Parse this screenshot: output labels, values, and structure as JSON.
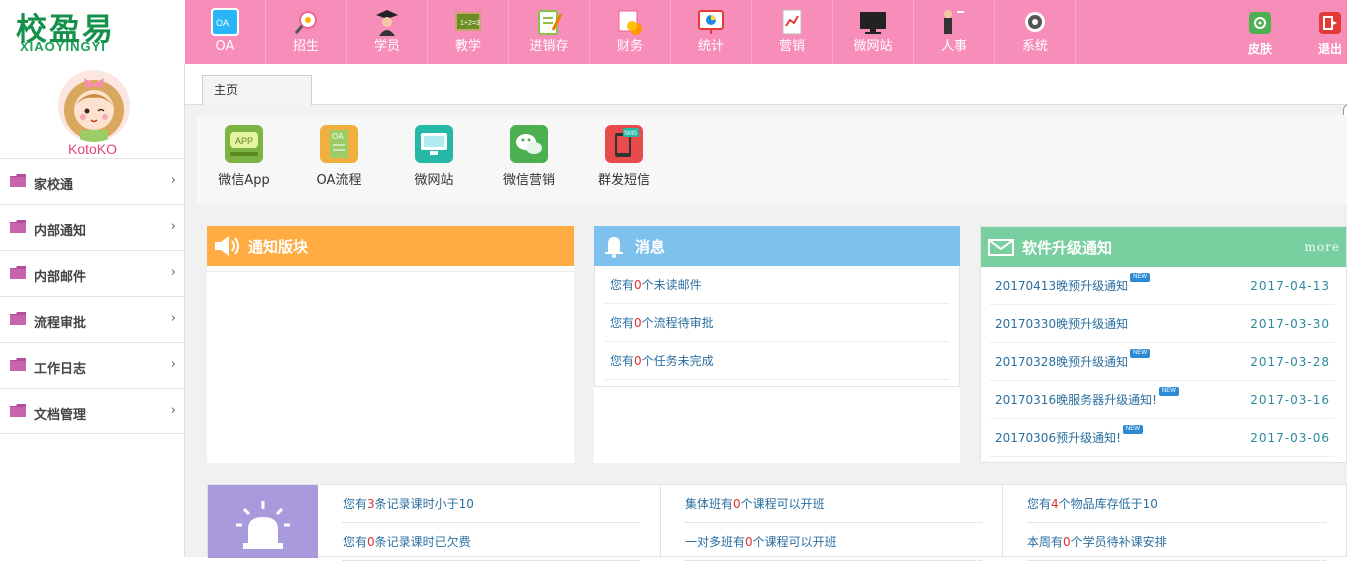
{
  "logo": {
    "cn": "校盈易",
    "en": "XIAOYINGYI"
  },
  "nav": [
    {
      "label": "OA",
      "icon": "oa-icon",
      "color": "#29b6f6"
    },
    {
      "label": "招生",
      "icon": "recruit-icon",
      "color": "#f06292"
    },
    {
      "label": "学员",
      "icon": "student-icon",
      "color": "#333333"
    },
    {
      "label": "教学",
      "icon": "teaching-icon",
      "color": "#8bc34a"
    },
    {
      "label": "进销存",
      "icon": "inventory-icon",
      "color": "#8bc34a"
    },
    {
      "label": "财务",
      "icon": "finance-icon",
      "color": "#ff9800"
    },
    {
      "label": "统计",
      "icon": "statistics-icon",
      "color": "#e53935"
    },
    {
      "label": "营销",
      "icon": "marketing-icon",
      "color": "#f5f5f5"
    },
    {
      "label": "微网站",
      "icon": "microsite-icon",
      "color": "#222222"
    },
    {
      "label": "人事",
      "icon": "personnel-icon",
      "color": "#333333"
    },
    {
      "label": "系统",
      "icon": "settings-icon",
      "color": "#444444"
    }
  ],
  "header_right": {
    "skin": {
      "label": "皮肤",
      "icon": "skin-icon",
      "color": "#4caf50"
    },
    "logout": {
      "label": "退出",
      "icon": "logout-icon",
      "color": "#e53935"
    }
  },
  "user": {
    "name": "KotoKO"
  },
  "sidebar": [
    {
      "label": "家校通"
    },
    {
      "label": "内部通知"
    },
    {
      "label": "内部邮件"
    },
    {
      "label": "流程审批"
    },
    {
      "label": "工作日志"
    },
    {
      "label": "文档管理"
    }
  ],
  "tabs": [
    {
      "label": "主页"
    }
  ],
  "shortcuts": [
    {
      "label": "微信App",
      "icon": "wechat-app-icon",
      "color": "#7cb342",
      "badge": "APP"
    },
    {
      "label": "OA流程",
      "icon": "oa-flow-icon",
      "color": "#f0b040",
      "badge": "OA"
    },
    {
      "label": "微网站",
      "icon": "microsite-icon",
      "color": "#26b8a6",
      "badge": ""
    },
    {
      "label": "微信营销",
      "icon": "wechat-marketing-icon",
      "color": "#4caf50",
      "badge": ""
    },
    {
      "label": "群发短信",
      "icon": "sms-icon",
      "color": "#e94b4b",
      "badge": "SMS"
    }
  ],
  "notice_panel": {
    "title": "通知版块",
    "color": "#ffac42"
  },
  "message_panel": {
    "title": "消息",
    "color": "#7ec1ec",
    "rows": [
      {
        "pre": "您有",
        "num": "0",
        "post": "个未读邮件"
      },
      {
        "pre": "您有",
        "num": "0",
        "post": "个流程待审批"
      },
      {
        "pre": "您有",
        "num": "0",
        "post": "个任务未完成"
      }
    ]
  },
  "upgrade_panel": {
    "title": "软件升级通知",
    "more": "more",
    "color": "#79cfa0",
    "new_badge": "NEW",
    "rows": [
      {
        "title": "20170413晚预升级通知",
        "date": "2017-04-13",
        "is_new": true
      },
      {
        "title": "20170330晚预升级通知",
        "date": "2017-03-30",
        "is_new": false
      },
      {
        "title": "20170328晚预升级通知",
        "date": "2017-03-28",
        "is_new": true
      },
      {
        "title": "20170316晚服务器升级通知!",
        "date": "2017-03-16",
        "is_new": true
      },
      {
        "title": "20170306预升级通知!",
        "date": "2017-03-06",
        "is_new": true
      }
    ]
  },
  "alerts": {
    "color": "#a999dd",
    "columns": [
      [
        {
          "pre": "您有",
          "num": "3",
          "post": "条记录课时小于10"
        },
        {
          "pre": "您有",
          "num": "0",
          "post": "条记录课时已欠费"
        }
      ],
      [
        {
          "pre": "集体班有",
          "num": "0",
          "post": "个课程可以开班"
        },
        {
          "pre": "一对多班有",
          "num": "0",
          "post": "个课程可以开班"
        }
      ],
      [
        {
          "pre": "您有",
          "num": "4",
          "post": "个物品库存低于10"
        },
        {
          "pre": "本周有",
          "num": "0",
          "post": "个学员待补课安排"
        }
      ]
    ]
  }
}
